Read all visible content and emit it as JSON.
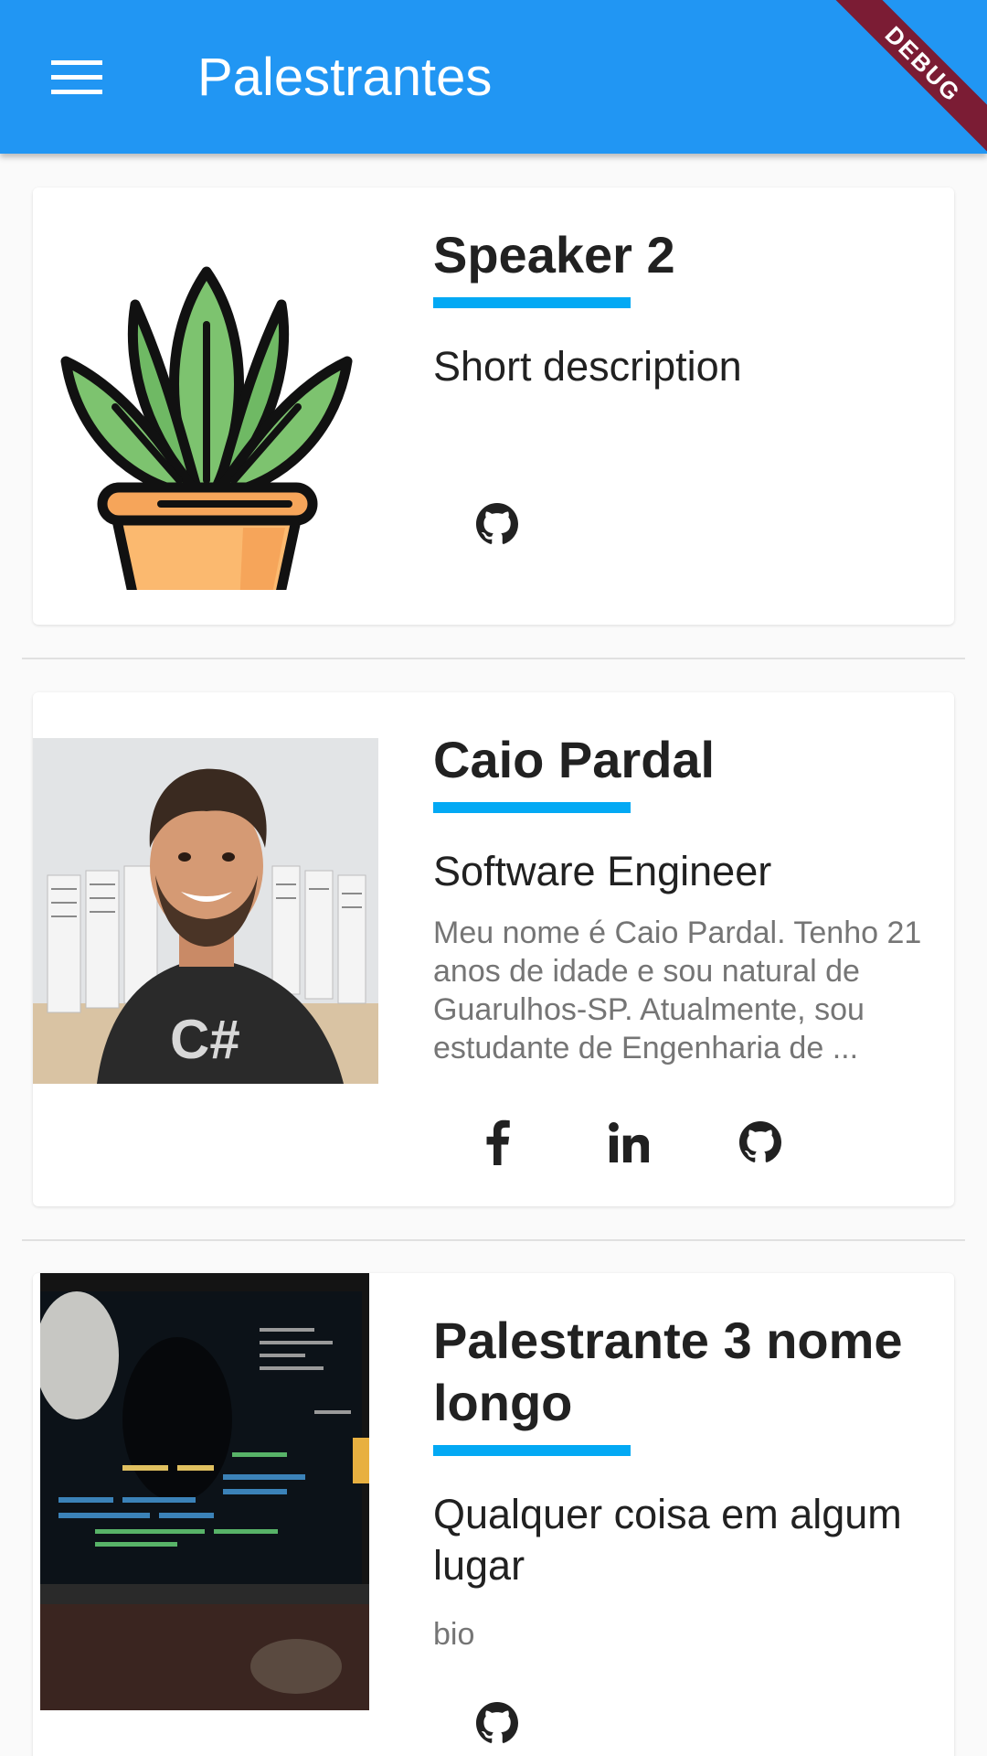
{
  "app_bar": {
    "title": "Palestrantes",
    "debug_banner": "DEBUG",
    "menu_icon": "hamburger-menu-icon"
  },
  "speakers": [
    {
      "name": "Speaker 2",
      "role": "Short description",
      "bio": "",
      "photo": "potted-plant-illustration",
      "social_links": [
        "github-icon"
      ]
    },
    {
      "name": "Caio Pardal",
      "role": "Software Engineer",
      "bio": "Meu nome é Caio Pardal. Tenho 21 anos de idade e sou natural de Guarulhos-SP. Atualmente, sou estudante de Engenharia de ...",
      "photo": "speaker-portrait-photo",
      "social_links": [
        "facebook-icon",
        "linkedin-icon",
        "github-icon"
      ]
    },
    {
      "name": "Palestrante 3 nome longo",
      "role": "Qualquer coisa em algum lugar",
      "bio": "bio",
      "photo": "computer-monitor-photo",
      "social_links": [
        "github-icon"
      ]
    }
  ],
  "colors": {
    "app_bar": "#2196f3",
    "accent_underline": "#03a9f4",
    "debug_banner": "#7b1c34",
    "background": "#fafafa"
  }
}
